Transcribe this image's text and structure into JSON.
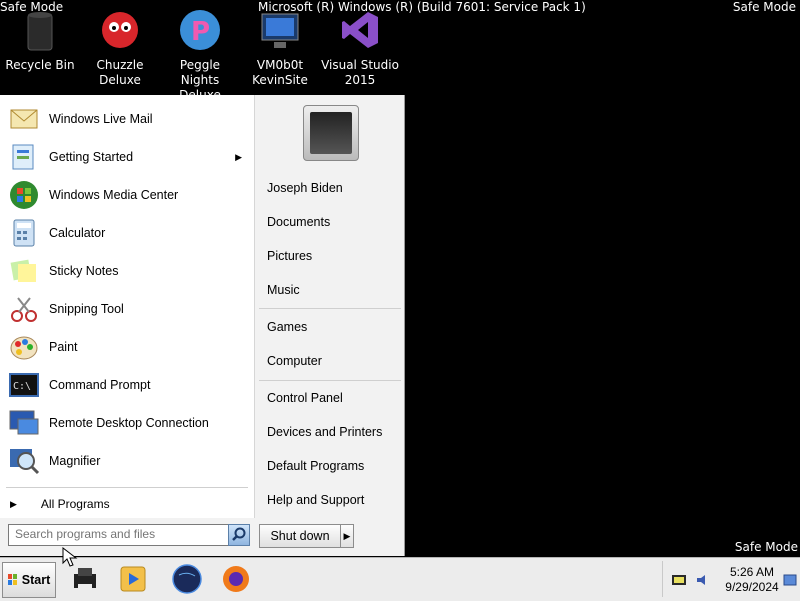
{
  "desktop": {
    "safe_mode_top_left": "Safe Mode",
    "safe_mode_top_right": "Safe Mode",
    "safe_mode_bottom_right": "Safe Mode",
    "build_text": "Microsoft (R) Windows (R) (Build 7601: Service Pack 1)",
    "icons": [
      {
        "label_line1": "Recycle Bin",
        "label_line2": "",
        "icon": "recycle-bin-icon"
      },
      {
        "label_line1": "Chuzzle",
        "label_line2": "Deluxe",
        "icon": "chuzzle-icon"
      },
      {
        "label_line1": "Peggle Nights",
        "label_line2": "Deluxe",
        "icon": "peggle-icon"
      },
      {
        "label_line1": "VM0b0t",
        "label_line2": "KevinSite",
        "icon": "vm-monitor-icon"
      },
      {
        "label_line1": "Visual Studio",
        "label_line2": "2015",
        "icon": "visual-studio-icon"
      }
    ]
  },
  "start_menu": {
    "programs": [
      {
        "label": "Windows Live Mail",
        "icon": "mail-icon"
      },
      {
        "label": "Getting Started",
        "icon": "getting-started-icon",
        "has_submenu": true
      },
      {
        "label": "Windows Media Center",
        "icon": "media-center-icon"
      },
      {
        "label": "Calculator",
        "icon": "calculator-icon"
      },
      {
        "label": "Sticky Notes",
        "icon": "sticky-notes-icon"
      },
      {
        "label": "Snipping Tool",
        "icon": "snipping-tool-icon"
      },
      {
        "label": "Paint",
        "icon": "paint-icon"
      },
      {
        "label": "Command Prompt",
        "icon": "command-prompt-icon"
      },
      {
        "label": "Remote Desktop Connection",
        "icon": "remote-desktop-icon"
      },
      {
        "label": "Magnifier",
        "icon": "magnifier-icon"
      }
    ],
    "all_programs": "All Programs",
    "search_placeholder": "Search programs and files",
    "right_items": {
      "user": "Joseph Biden",
      "documents": "Documents",
      "pictures": "Pictures",
      "music": "Music",
      "games": "Games",
      "computer": "Computer",
      "control_panel": "Control Panel",
      "devices_printers": "Devices and Printers",
      "default_programs": "Default Programs",
      "help_support": "Help and Support"
    },
    "shutdown_label": "Shut down"
  },
  "taskbar": {
    "start_label": "Start",
    "time": "5:26 AM",
    "date": "9/29/2024"
  },
  "colors": {
    "desktop_bg": "#000000",
    "menu_left_bg": "#ffffff",
    "menu_right_bg": "#f2f2f2",
    "taskbar_bg": "#ececec"
  }
}
